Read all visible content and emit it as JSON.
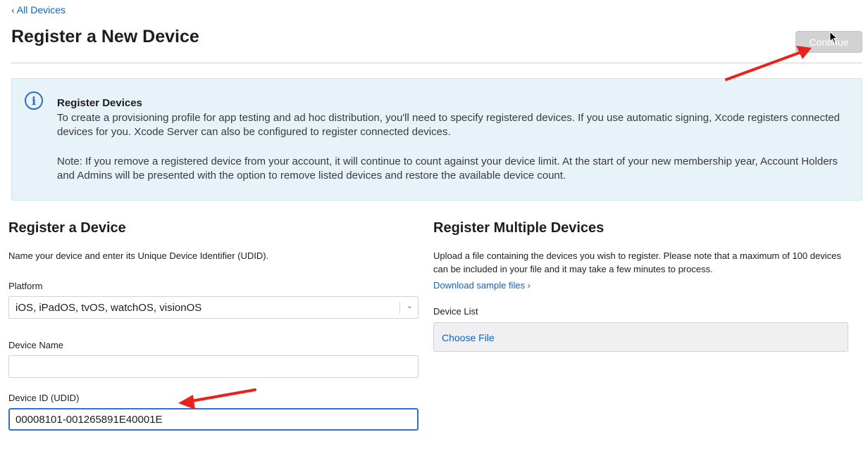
{
  "nav": {
    "back_label": "‹ All Devices"
  },
  "header": {
    "title": "Register a New Device",
    "continue_label": "Continue"
  },
  "info": {
    "icon": "info-icon",
    "title": "Register Devices",
    "body": "To create a provisioning profile for app testing and ad hoc distribution, you'll need to specify registered devices. If you use automatic signing, Xcode registers connected devices for you. Xcode Server can also be configured to register connected devices.",
    "note": "Note: If you remove a registered device from your account, it will continue to count against your device limit. At the start of your new membership year, Account Holders and Admins will be presented with the option to remove listed devices and restore the available device count."
  },
  "single": {
    "title": "Register a Device",
    "description": "Name your device and enter its Unique Device Identifier (UDID).",
    "platform_label": "Platform",
    "platform_value": "iOS, iPadOS, tvOS, watchOS, visionOS",
    "name_label": "Device Name",
    "name_value": "",
    "udid_label": "Device ID (UDID)",
    "udid_value": "00008101-001265891E40001E"
  },
  "multiple": {
    "title": "Register Multiple Devices",
    "description": "Upload a file containing the devices you wish to register. Please note that a maximum of 100 devices can be included in your file and it may take a few minutes to process.",
    "download_link": "Download sample files ›",
    "list_label": "Device List",
    "choose_file_label": "Choose File"
  },
  "colors": {
    "accent": "#0b63c5",
    "annotation_arrow": "#e8231b",
    "info_bg": "#e8f2f9"
  }
}
